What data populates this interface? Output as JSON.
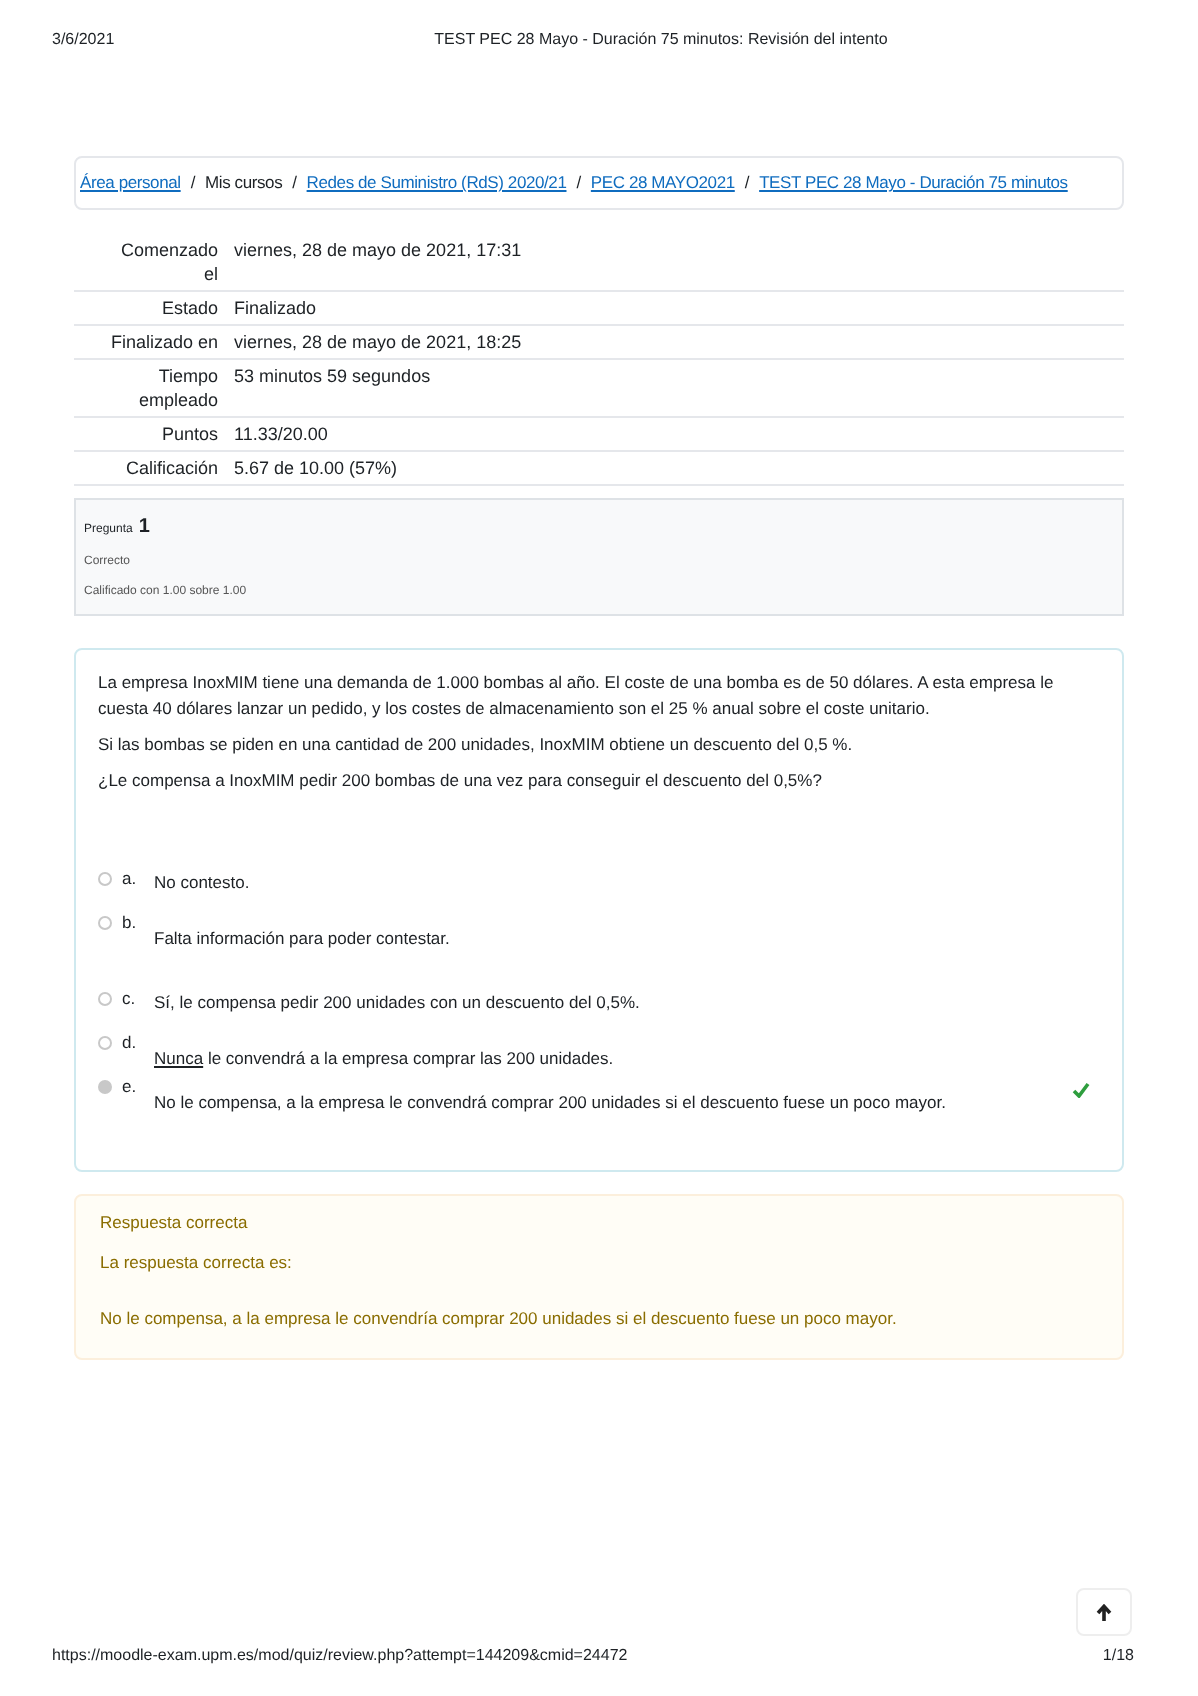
{
  "print_header": {
    "date": "3/6/2021",
    "title": "TEST PEC 28 Mayo - Duración 75 minutos: Revisión del intento"
  },
  "breadcrumb": [
    {
      "label": "Área personal",
      "link": true
    },
    {
      "separator": "/",
      "label": "Mis cursos",
      "link": false
    },
    {
      "separator": "/",
      "label": "Redes de Suministro (RdS) 2020/21",
      "link": true
    },
    {
      "separator": "/",
      "label": "PEC 28 MAYO2021",
      "link": true
    },
    {
      "separator": "/",
      "label": "TEST PEC 28 Mayo - Duración 75 minutos",
      "link": true
    }
  ],
  "summary": [
    {
      "label": "Comenzado el",
      "value": "viernes, 28 de mayo de 2021, 17:31"
    },
    {
      "label": "Estado",
      "value": "Finalizado"
    },
    {
      "label": "Finalizado en",
      "value": "viernes, 28 de mayo de 2021, 18:25"
    },
    {
      "label": "Tiempo empleado",
      "value": "53 minutos 59 segundos"
    },
    {
      "label": "Puntos",
      "value": "11.33/20.00"
    },
    {
      "label": "Calificación",
      "value": "5.67 de 10.00 (57%)"
    }
  ],
  "question_info": {
    "label": "Pregunta",
    "number": "1",
    "status": "Correcto",
    "grade": "Calificado con 1.00 sobre 1.00"
  },
  "question": {
    "paragraphs": [
      "La empresa InoxMIM tiene una demanda de 1.000 bombas al año. El coste de una bomba es de 50 dólares. A esta empresa le cuesta 40 dólares lanzar un pedido, y los costes de almacenamiento son el 25 % anual sobre el coste unitario.",
      "Si las bombas se piden en una cantidad de 200 unidades, InoxMIM obtiene un descuento del 0,5 %.",
      "¿Le compensa a InoxMIM pedir 200 bombas de una vez para conseguir el descuento del 0,5%?"
    ],
    "options": [
      {
        "letter": "a.",
        "parts": [
          {
            "text": "No contesto.",
            "underline": false
          }
        ],
        "selected": false,
        "correct": false
      },
      {
        "letter": "b.",
        "parts": [
          {
            "text": "Falta información para poder contestar.",
            "underline": false
          }
        ],
        "selected": false,
        "correct": false
      },
      {
        "letter": "c.",
        "parts": [
          {
            "text": "Sí, le compensa pedir 200 unidades con un descuento del 0,5%.",
            "underline": false
          }
        ],
        "selected": false,
        "correct": false
      },
      {
        "letter": "d.",
        "parts": [
          {
            "text": "Nunca",
            "underline": true
          },
          {
            "text": " le convendrá a la empresa comprar las 200 unidades.",
            "underline": false
          }
        ],
        "selected": false,
        "correct": false
      },
      {
        "letter": "e.",
        "parts": [
          {
            "text": "No le compensa, a la empresa le convendrá comprar 200 unidades si el descuento fuese un poco mayor.",
            "underline": false
          }
        ],
        "selected": true,
        "correct": true
      }
    ]
  },
  "feedback": {
    "title": "Respuesta correcta",
    "intro": "La respuesta correcta es:",
    "answer": "No le compensa, a la empresa le convendría comprar 200 unidades si el descuento fuese un poco mayor."
  },
  "print_footer": {
    "url": "https://moodle-exam.upm.es/mod/quiz/review.php?attempt=144209&cmid=24472",
    "page": "1/18"
  }
}
